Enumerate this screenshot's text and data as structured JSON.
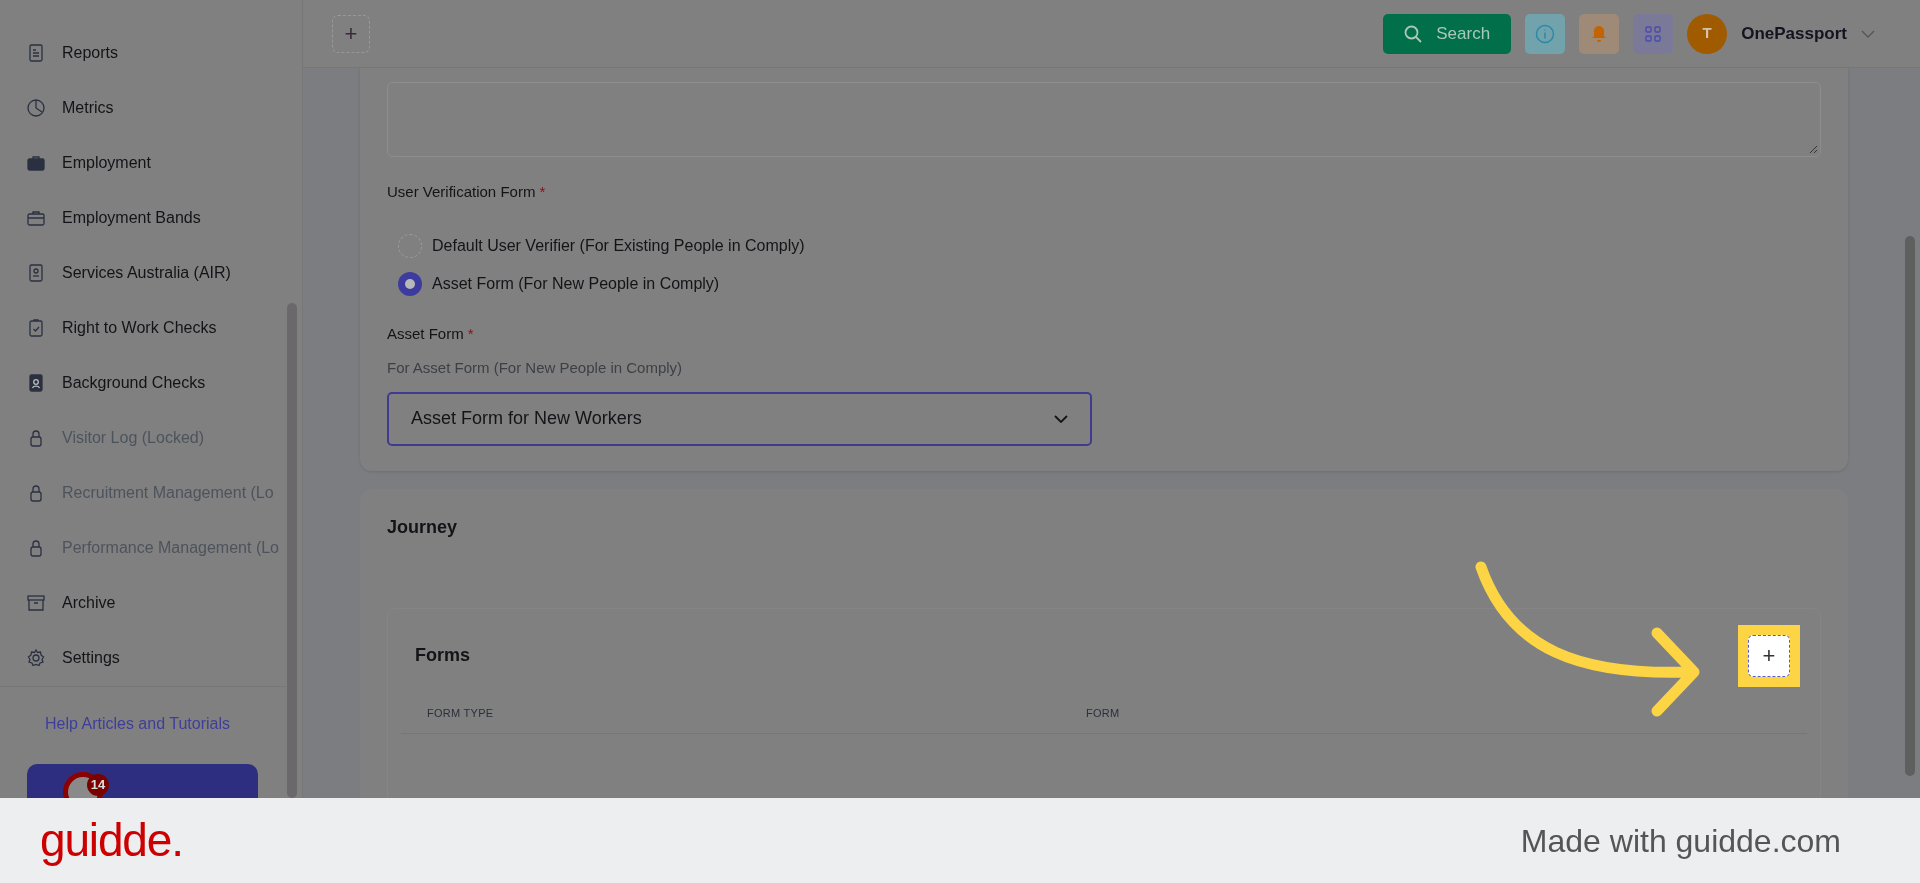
{
  "header": {
    "add_button": "+",
    "search_button": "Search",
    "user": {
      "avatar_initial": "T",
      "name": "OnePassport"
    }
  },
  "sidebar": {
    "items": [
      {
        "label": "Reports",
        "locked": false
      },
      {
        "label": "Metrics",
        "locked": false
      },
      {
        "label": "Employment",
        "locked": false
      },
      {
        "label": "Employment Bands",
        "locked": false
      },
      {
        "label": "Services Australia (AIR)",
        "locked": false
      },
      {
        "label": "Right to Work Checks",
        "locked": false
      },
      {
        "label": "Background Checks",
        "locked": false
      },
      {
        "label": "Visitor Log (Locked)",
        "locked": true
      },
      {
        "label": "Recruitment Management (Lo",
        "locked": true
      },
      {
        "label": "Performance Management (Lo",
        "locked": true
      },
      {
        "label": "Archive",
        "locked": false
      },
      {
        "label": "Settings",
        "locked": false
      }
    ],
    "help_link": "Help Articles and Tutorials",
    "workspace_card": {
      "badge": "14"
    }
  },
  "verification": {
    "label": "User Verification Form",
    "required_mark": "*",
    "options": [
      {
        "label": "Default User Verifier (For Existing People in Comply)",
        "selected": false
      },
      {
        "label": "Asset Form (For New People in Comply)",
        "selected": true
      }
    ]
  },
  "asset_form": {
    "label": "Asset Form",
    "required_mark": "*",
    "helper": "For Asset Form (For New People in Comply)",
    "value": "Asset Form for New Workers"
  },
  "journey": {
    "title": "Journey",
    "forms": {
      "title": "Forms",
      "add_button": "+",
      "highlighted": true,
      "columns": [
        "FORM TYPE",
        "FORM"
      ]
    }
  },
  "footer": {
    "logo": "guidde.",
    "credit": "Made with guidde.com"
  }
}
